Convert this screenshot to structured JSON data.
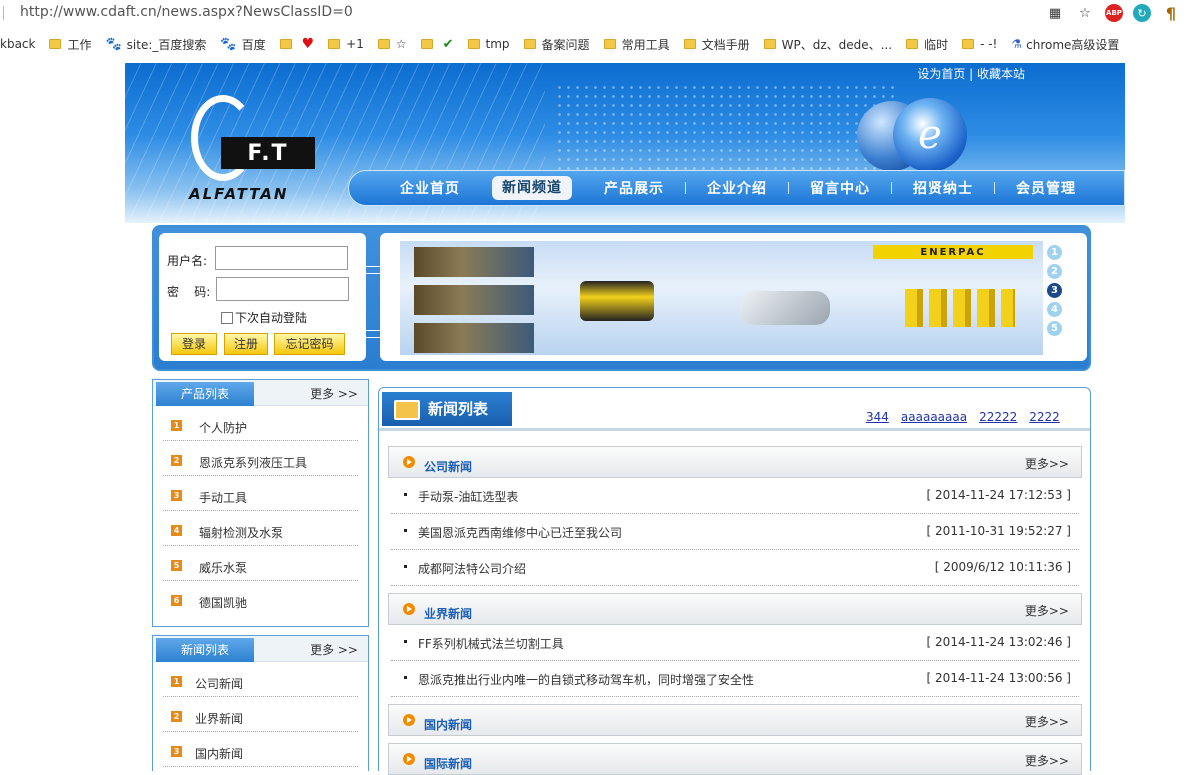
{
  "browser": {
    "url": "http://www.cdaft.cn/news.aspx?NewsClassID=0",
    "bookmarks": [
      "kback",
      "工作",
      "site:_百度搜索",
      "百度",
      "",
      "+1",
      "☆",
      "",
      "tmp",
      "备案问题",
      "常用工具",
      "文档手册",
      "WP、dz、dede、...",
      "临时",
      "- -!",
      "chrome高级设置"
    ]
  },
  "site": {
    "toplinks": "设为首页 | 收藏本站",
    "logo_box": "F.T",
    "logo_word": "ALFATTAN",
    "nav": [
      "企业首页",
      "新闻频道",
      "产品展示",
      "企业介绍",
      "留言中心",
      "招贤纳士",
      "会员管理"
    ],
    "login": {
      "user_label": "用户名:",
      "pass_label": "密    码:",
      "remember": "下次自动登陆",
      "login_btn": "登录",
      "register_btn": "注册",
      "forgot_btn": "忘记密码"
    },
    "banner": {
      "brand": "ENERPAC",
      "dots": [
        "1",
        "2",
        "3",
        "4",
        "5"
      ],
      "active_dot": 3
    },
    "product_list": {
      "title": "产品列表",
      "more": "更多 >>",
      "items": [
        "个人防护",
        "恩派克系列液压工具",
        "手动工具",
        "辐射检测及水泵",
        "威乐水泵",
        "德国凯驰"
      ]
    },
    "news_list": {
      "title": "新闻列表",
      "more": "更多 >>",
      "items": [
        "公司新闻",
        "业界新闻",
        "国内新闻"
      ]
    },
    "main": {
      "title": "新闻列表",
      "links": [
        "344",
        "aaaaaaaaa",
        "22222",
        "2222"
      ],
      "sections": [
        {
          "name": "公司新闻",
          "more": "更多>>",
          "rows": [
            {
              "title": "手动泵-油缸选型表",
              "date": "[ 2014-11-24 17:12:53 ]"
            },
            {
              "title": "美国恩派克西南维修中心已迁至我公司",
              "date": "[ 2011-10-31 19:52:27 ]"
            },
            {
              "title": "成都阿法特公司介绍",
              "date": "[ 2009/6/12 10:11:36 ]"
            }
          ]
        },
        {
          "name": "业界新闻",
          "more": "更多>>",
          "rows": [
            {
              "title": "FF系列机械式法兰切割工具",
              "date": "[ 2014-11-24 13:02:46 ]"
            },
            {
              "title": "恩派克推出行业内唯一的自锁式移动驾车机，同时增强了安全性",
              "date": "[ 2014-11-24 13:00:56 ]"
            }
          ]
        },
        {
          "name": "国内新闻",
          "more": "更多>>",
          "rows": []
        },
        {
          "name": "国际新闻",
          "more": "更多>>",
          "rows": []
        }
      ]
    }
  }
}
